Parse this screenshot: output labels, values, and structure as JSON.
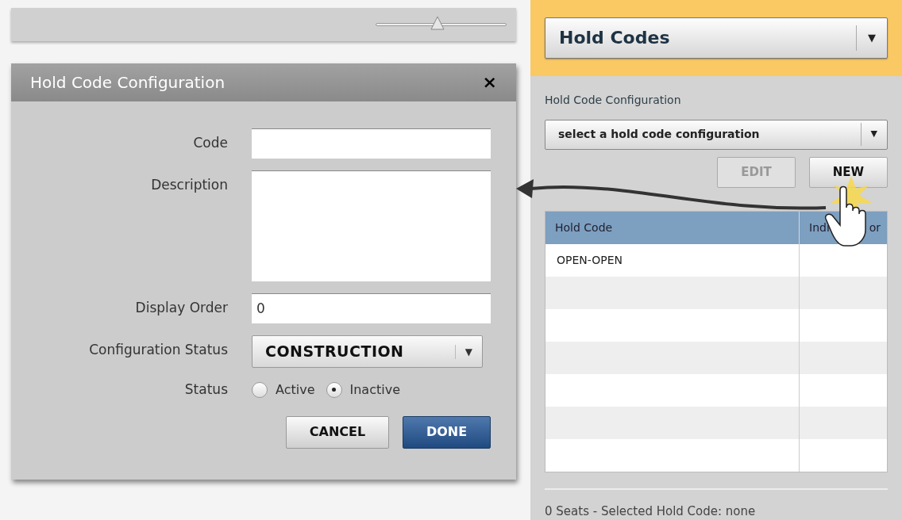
{
  "toolbar": {
    "zoom_slider": {
      "level": 0.47
    }
  },
  "dialog": {
    "title": "Hold Code Configuration",
    "close": "×",
    "fields": [
      {
        "kind": "text",
        "label": "Code"
      },
      {
        "kind": "textarea",
        "label": "Description"
      },
      {
        "kind": "text",
        "label": "Display Order",
        "value": "0"
      },
      {
        "kind": "select",
        "label": "Configuration Status",
        "value": "CONSTRUCTION",
        "caret": "▼"
      },
      {
        "kind": "radio",
        "label": "Status",
        "options": [
          {
            "label": "Active",
            "selected": false
          },
          {
            "label": "Inactive",
            "selected": true
          }
        ]
      }
    ],
    "buttons": [
      {
        "label": "CANCEL",
        "kind": "secondary"
      },
      {
        "label": "DONE",
        "kind": "primary"
      }
    ]
  },
  "panel": {
    "view_select": {
      "value": "Hold Codes",
      "caret": "▼"
    },
    "config_label": "Hold Code Configuration",
    "config_select": {
      "value": "select a hold code configuration",
      "caret": "▼"
    },
    "buttons": [
      {
        "label": "EDIT",
        "disabled": true
      },
      {
        "label": "NEW",
        "disabled": false
      }
    ],
    "table": {
      "columns": [
        {
          "parts": [
            "Hold Code"
          ]
        },
        {
          "parts": [
            "Indi",
            "or"
          ]
        }
      ],
      "rows": [
        [
          "OPEN-OPEN"
        ]
      ]
    },
    "footer": "0 Seats - Selected Hold Code: none"
  }
}
